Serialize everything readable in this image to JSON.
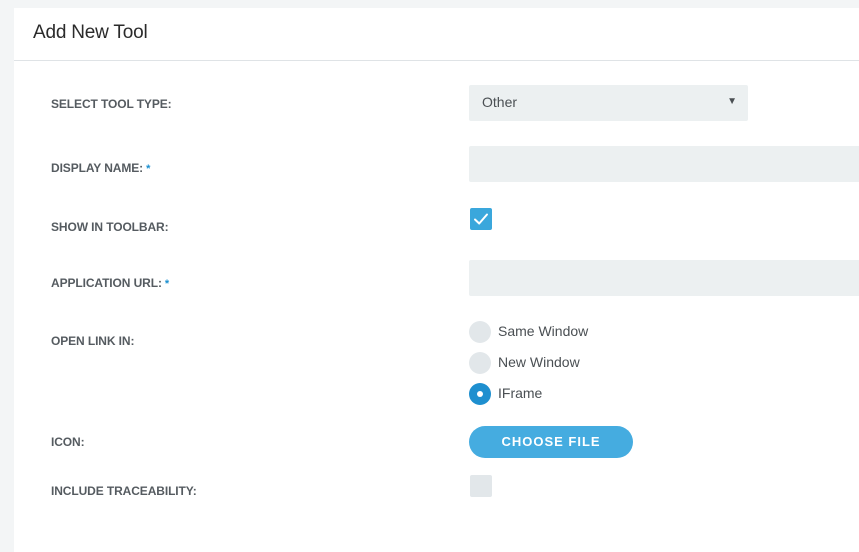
{
  "form": {
    "title": "Add New Tool",
    "tool_type": {
      "label": "SELECT TOOL TYPE:",
      "value": "Other"
    },
    "display_name": {
      "label": "DISPLAY NAME:",
      "required_mark": "*",
      "value": ""
    },
    "show_in_toolbar": {
      "label": "SHOW IN TOOLBAR:",
      "checked": true
    },
    "application_url": {
      "label": "APPLICATION URL:",
      "required_mark": "*",
      "value": ""
    },
    "open_link_in": {
      "label": "OPEN LINK IN:",
      "options": [
        {
          "label": "Same Window",
          "selected": false
        },
        {
          "label": "New Window",
          "selected": false
        },
        {
          "label": "IFrame",
          "selected": true
        }
      ]
    },
    "icon": {
      "label": "ICON:",
      "button_label": "CHOOSE FILE"
    },
    "include_traceability": {
      "label": "INCLUDE TRACEABILITY:",
      "checked": false
    }
  },
  "colors": {
    "accent": "#3aa7dc",
    "radio_selected": "#1e8fcf",
    "field_background": "#ecf0f1",
    "button": "#45ace0"
  },
  "icons": [
    "dropdown-arrow-icon",
    "checkmark-icon",
    "radio-dot-icon"
  ]
}
